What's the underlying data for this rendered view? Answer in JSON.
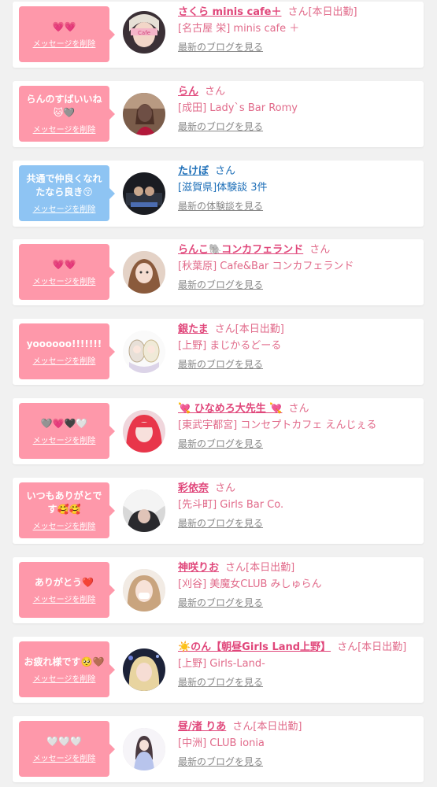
{
  "delete_label": "メッセージを削除",
  "san": "さん",
  "colors": {
    "pink_bubble": "#fe98aa",
    "blue_bubble": "#8ec4f3",
    "name_pink": "#e0467a",
    "name_blue": "#1e6fb8"
  },
  "items": [
    {
      "message": "💗💗",
      "name": "さくら minis cafe＋",
      "work": "[本日出勤]",
      "shop": "[名古屋 栄] minis cafe ＋",
      "blog": "最新のブログを見る",
      "style": "pink"
    },
    {
      "message": "らんのすばいいね🐱🩶",
      "name": "らん",
      "work": "",
      "shop": "[成田] Lady`s Bar Romy",
      "blog": "最新のブログを見る",
      "style": "pink"
    },
    {
      "message": "共通で仲良くなれたなら良き😚",
      "name": "たけぼ",
      "work": "",
      "shop": "[滋賀県]体験談 3件",
      "blog": "最新の体験談を見る",
      "style": "blue"
    },
    {
      "message": "💗💗",
      "name": "らんこ🐘コンカフェランド",
      "work": "",
      "shop": "[秋葉原] Cafe&Bar コンカフェランド",
      "blog": "最新のブログを見る",
      "style": "pink"
    },
    {
      "message": "yoooooo!!!!!!!",
      "name": "銀たま",
      "work": "[本日出勤]",
      "shop": "[上野] まじかるどーる",
      "blog": "最新のブログを見る",
      "style": "pink"
    },
    {
      "message": "🩶💗🖤🤍",
      "name": "💘 ひなめろ大先生 💘",
      "work": "",
      "shop": "[東武宇都宮] コンセプトカフェ えんじぇる",
      "blog": "最新のブログを見る",
      "style": "pink"
    },
    {
      "message": "いつもありがとです🥰🥰",
      "name": "彩依奈",
      "work": "",
      "shop": "[先斗町] Girls Bar Co.",
      "blog": "最新のブログを見る",
      "style": "pink"
    },
    {
      "message": "ありがとう❤️",
      "name": "神咲りお",
      "work": "[本日出勤]",
      "shop": "[刈谷] 美魔女CLUB みしゅらん",
      "blog": "最新のブログを見る",
      "style": "pink"
    },
    {
      "message": "お疲れ様です🥺🤎",
      "name": "☀️のん【朝昼Girls Land上野】",
      "work": "[本日出勤]",
      "shop": "[上野] Girls-Land-",
      "blog": "最新のブログを見る",
      "style": "pink"
    },
    {
      "message": "🤍🤍🤍",
      "name": "昼/渚 りあ",
      "work": "[本日出勤]",
      "shop": "[中洲] CLUB ionia",
      "blog": "最新のブログを見る",
      "style": "pink"
    }
  ]
}
